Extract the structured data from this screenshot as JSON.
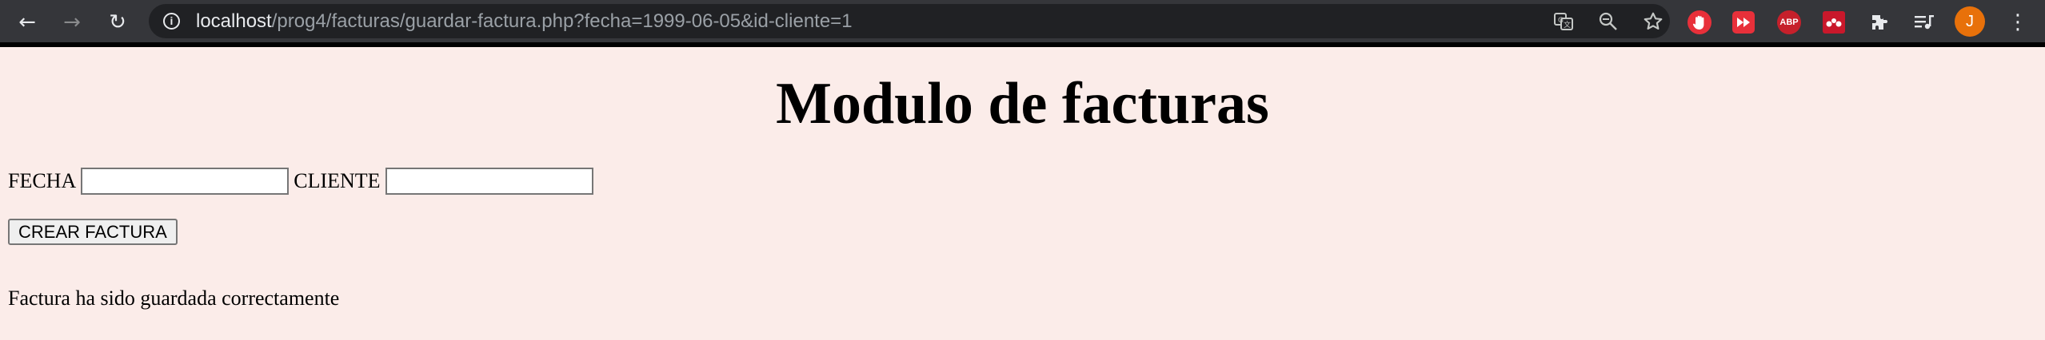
{
  "browser": {
    "url_host": "localhost",
    "url_path": "/prog4/facturas/guardar-factura.php?fecha=1999-06-05&id-cliente=1",
    "info_glyph": "i",
    "nav": {
      "back_glyph": "←",
      "forward_glyph": "→",
      "reload_glyph": "↻"
    },
    "omnibox_icons": {
      "translate": "translate-icon",
      "zoom": "zoom-out-icon",
      "bookmark": "star-icon"
    },
    "extensions": [
      {
        "name": "hand-extension-icon",
        "glyph": "✋",
        "color": "#e8303a"
      },
      {
        "name": "fast-forward-extension-icon",
        "glyph": "⏩",
        "color": "#e8303a"
      },
      {
        "name": "adblock-plus-icon",
        "glyph": "ABP",
        "color": "#c6202b"
      },
      {
        "name": "mendeley-extension-icon",
        "glyph": "M",
        "color": "#c9182b"
      },
      {
        "name": "extensions-puzzle-icon",
        "glyph": "✚",
        "color": "#35363a"
      },
      {
        "name": "media-playlist-icon",
        "glyph": "≡",
        "color": "#35363a"
      }
    ],
    "avatar_initial": "J",
    "avatar_color": "#e8710a",
    "menu_glyph": "⋮"
  },
  "page": {
    "title": "Modulo de facturas",
    "fecha_label": "FECHA",
    "fecha_value": "",
    "cliente_label": "CLIENTE",
    "cliente_value": "",
    "submit_label": "CREAR FACTURA",
    "status_message": "Factura ha sido guardada correctamente",
    "background_color": "#fbece9"
  }
}
